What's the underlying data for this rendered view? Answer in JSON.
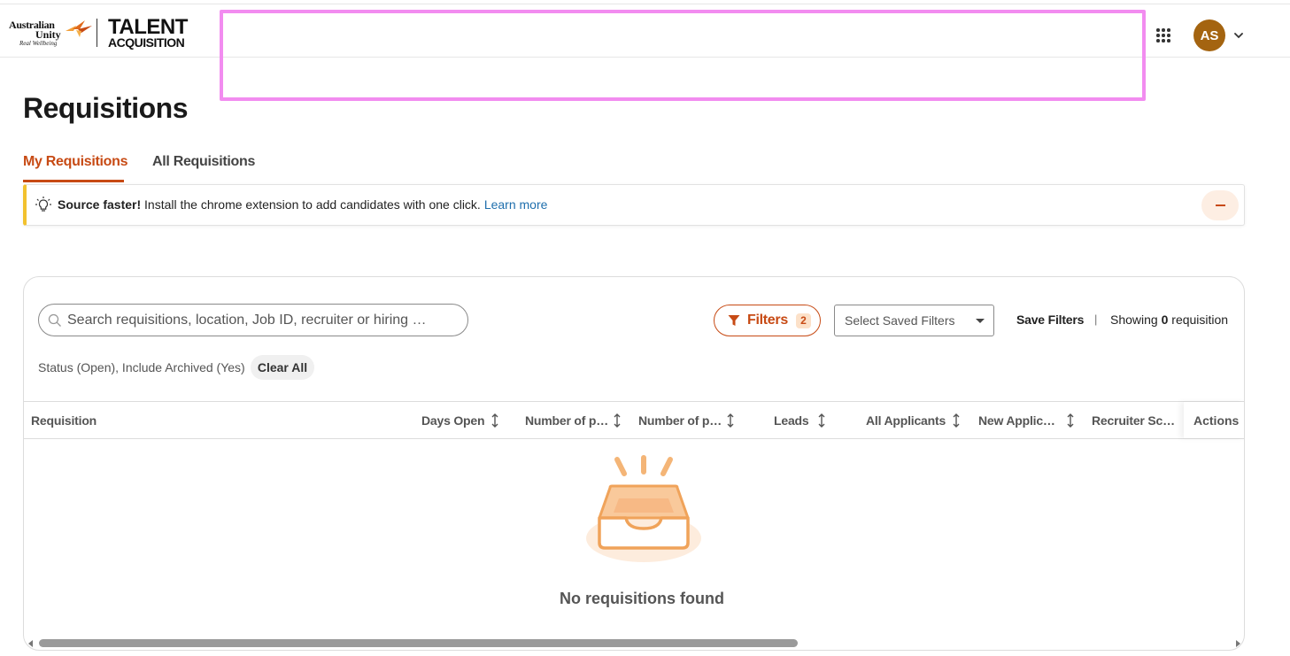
{
  "header": {
    "brand_line1": "Australian",
    "brand_line2": "Unity",
    "brand_tagline": "Real Wellbeing",
    "product_line1": "TALENT",
    "product_line2": "ACQUISITION",
    "avatar_initials": "AS",
    "accent_color": "#c74a14",
    "avatar_color": "#a46410"
  },
  "page": {
    "title": "Requisitions"
  },
  "tabs": [
    {
      "label": "My Requisitions",
      "active": true
    },
    {
      "label": "All Requisitions",
      "active": false
    }
  ],
  "banner": {
    "bold": "Source faster!",
    "text": " Install the chrome extension to add candidates with one click.",
    "link": "Learn more"
  },
  "toolbar": {
    "search_placeholder": "Search requisitions, location, Job ID, recruiter or hiring …",
    "filters_label": "Filters",
    "filters_count": "2",
    "saved_filters_placeholder": "Select Saved Filters",
    "save_filters_label": "Save Filters",
    "separator": "|",
    "showing_prefix": "Showing ",
    "showing_count": "0",
    "showing_suffix": " requisition"
  },
  "active_filters": {
    "text": "Status (Open), Include Archived (Yes)",
    "clear_label": "Clear All"
  },
  "table": {
    "columns": [
      "Requisition",
      "Days Open",
      "Number of p…",
      "Number of p…",
      "Leads",
      "All Applicants",
      "New Applic…",
      "Recruiter Sc…",
      "Actions"
    ],
    "rows": [],
    "empty_message": "No requisitions found"
  }
}
